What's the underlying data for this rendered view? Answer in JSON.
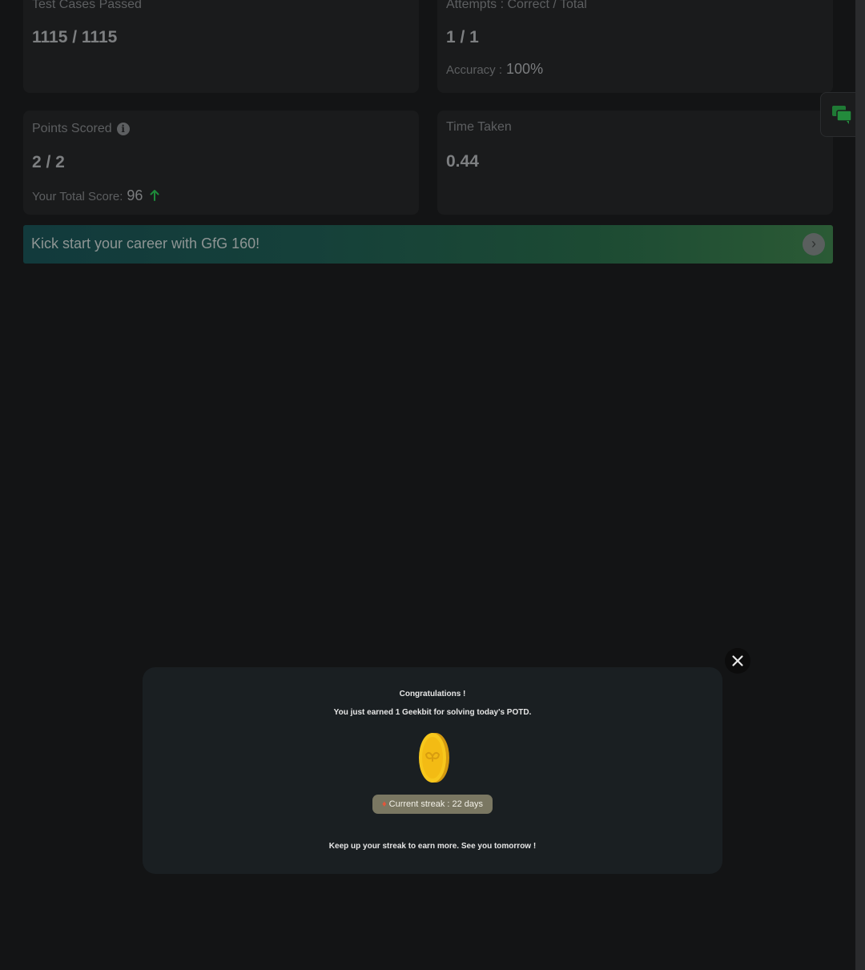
{
  "stats": {
    "test_cases": {
      "label": "Test Cases Passed",
      "value": "1115 / 1115"
    },
    "attempts": {
      "label": "Attempts : Correct / Total",
      "value": "1 / 1",
      "accuracy_label": "Accuracy :",
      "accuracy_value": "100%"
    },
    "points": {
      "label": "Points Scored",
      "value": "2 / 2",
      "total_label": "Your Total Score:",
      "total_value": "96"
    },
    "time": {
      "label": "Time Taken",
      "value": "0.44"
    }
  },
  "banner": {
    "text": "Kick start your career with GfG 160!"
  },
  "modal": {
    "title": "Congratulations !",
    "message": "You just earned 1 Geekbit for solving today's POTD.",
    "streak": "Current streak : 22 days",
    "footer": "Keep up your streak to earn more. See you tomorrow !"
  },
  "icons": {
    "info": "info-icon",
    "arrow_up": "arrow-up-icon",
    "chevron": "chevron-right-icon",
    "chat": "chat-icon",
    "coin": "geekbit-coin-icon",
    "fire": "fire-icon",
    "close": "close-icon"
  },
  "colors": {
    "background": "#131415",
    "up_arrow": "#1e8a3a",
    "chat_icon": "#1f7a35",
    "coin": "#f5c518",
    "streak_pill": "#7a7762"
  }
}
